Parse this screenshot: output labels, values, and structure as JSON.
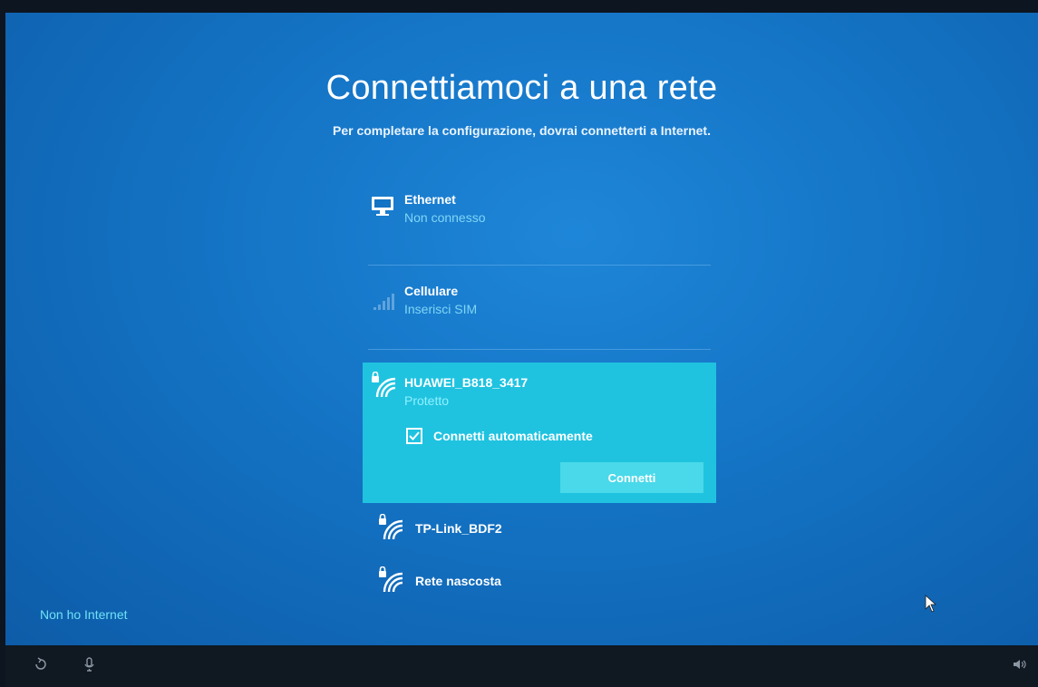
{
  "header": {
    "title": "Connettiamoci a una rete",
    "subtitle": "Per completare la configurazione, dovrai connetterti a Internet."
  },
  "networks": {
    "ethernet": {
      "name": "Ethernet",
      "status": "Non connesso",
      "icon": "ethernet-icon"
    },
    "cellular": {
      "name": "Cellulare",
      "status": "Inserisci SIM",
      "icon": "cellular-signal-icon"
    },
    "wifi_selected": {
      "name": "HUAWEI_B818_3417",
      "status": "Protetto",
      "icon": "secured-wifi-icon",
      "auto_connect_label": "Connetti automaticamente",
      "auto_connect_checked": true,
      "connect_label": "Connetti"
    },
    "wifi_others": [
      {
        "name": "TP-Link_BDF2",
        "icon": "secured-wifi-icon"
      },
      {
        "name": "Rete nascosta",
        "icon": "secured-wifi-icon"
      }
    ]
  },
  "footer": {
    "no_internet_label": "Non ho Internet"
  },
  "taskbar": {
    "icons": [
      "ease-of-access-icon",
      "microphone-icon",
      "volume-icon"
    ]
  },
  "colors": {
    "background": "#1473c4",
    "selected_row": "#1fc3e0",
    "connect_button": "#49d9ea",
    "status_text": "#7fd6f5",
    "link_text": "#6fe1f6",
    "taskbar": "#101821"
  }
}
